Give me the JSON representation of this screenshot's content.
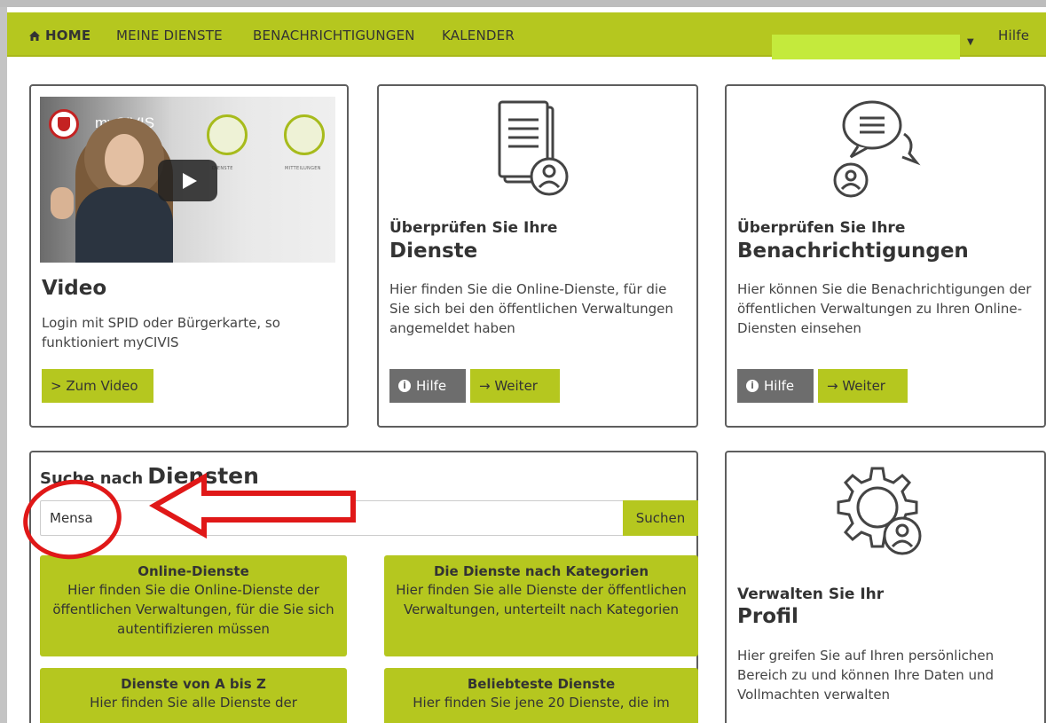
{
  "nav": {
    "home": "HOME",
    "services": "MEINE DIENSTE",
    "notifications": "BENACHRICHTIGUNGEN",
    "calendar": "KALENDER",
    "help": "Hilfe"
  },
  "video_card": {
    "thumb_title": "myCIVIS",
    "thumb_caption_1": "DIENSTE",
    "thumb_caption_2": "MITTEILUNGEN",
    "title": "Video",
    "text": "Login mit SPID oder Bürgerkarte, so funktioniert myCIVIS",
    "button": "> Zum Video"
  },
  "services_card": {
    "title_small": "Überprüfen Sie Ihre",
    "title_big": "Dienste",
    "text": "Hier finden Sie die Online-Dienste, für die Sie sich bei den öffentlichen Verwaltungen angemeldet haben",
    "help_button": "Hilfe",
    "next_button": "→ Weiter"
  },
  "notifications_card": {
    "title_small": "Überprüfen Sie Ihre",
    "title_big": "Benachrichtigungen",
    "text": "Hier können Sie die Benachrichtigungen der öffentlichen Verwaltungen zu Ihren Online-Diensten einsehen",
    "help_button": "Hilfe",
    "next_button": "→ Weiter"
  },
  "search_card": {
    "title_prefix": "Suche nach",
    "title_main": "Diensten",
    "input_value": "Mensa",
    "search_button": "Suchen",
    "tiles": [
      {
        "title": "Online-Dienste",
        "text": "Hier finden Sie die Online-Dienste der öffentlichen Verwaltungen, für die Sie sich autentifizieren müssen"
      },
      {
        "title": "Die Dienste nach Kategorien",
        "text": "Hier finden Sie alle Dienste der öffentlichen Verwaltungen, unterteilt nach Kategorien"
      },
      {
        "title": "Dienste von A bis Z",
        "text": "Hier finden Sie alle Dienste der"
      },
      {
        "title": "Beliebteste Dienste",
        "text": "Hier finden Sie jene 20 Dienste, die im"
      }
    ]
  },
  "profile_card": {
    "title_small": "Verwalten Sie Ihr",
    "title_big": "Profil",
    "text": "Hier greifen Sie auf Ihren persönlichen Bereich zu und können Ihre Daten und Vollmachten verwalten"
  },
  "colors": {
    "brand_green": "#b5c71f",
    "highlight_green": "#c4ea3c",
    "annotation_red": "#e01818",
    "button_gray": "#6d6d6d"
  }
}
